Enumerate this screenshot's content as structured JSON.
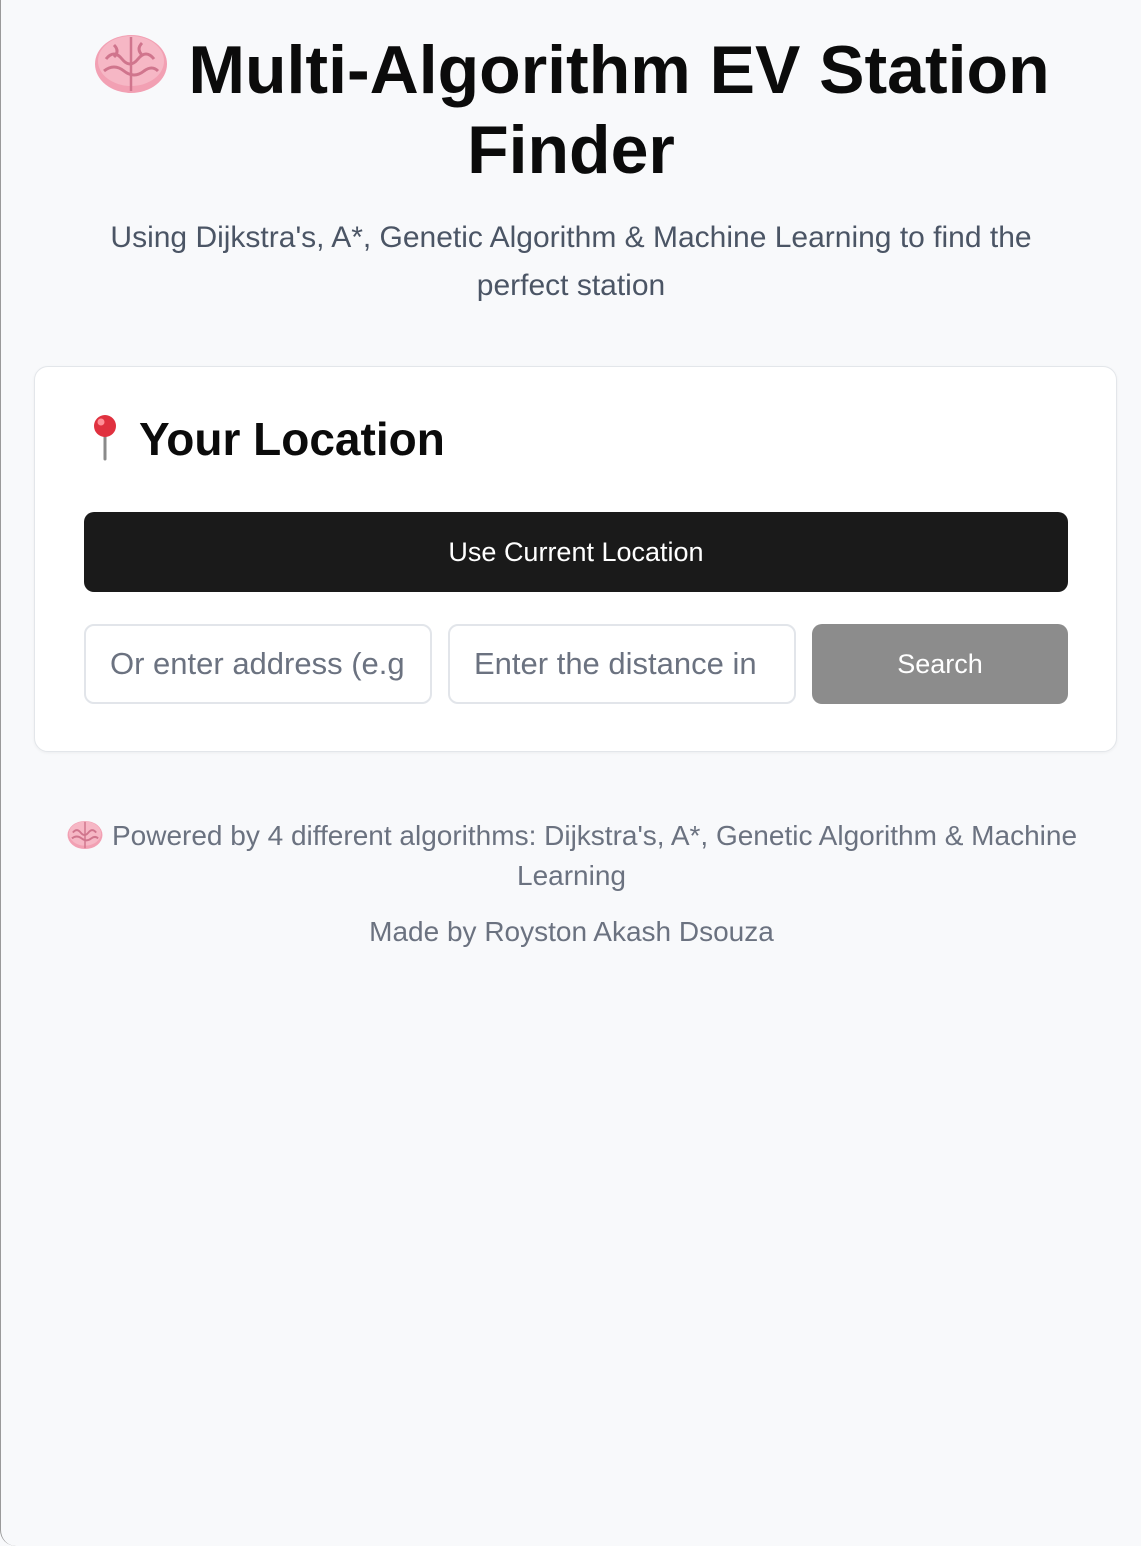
{
  "header": {
    "title": "Multi-Algorithm EV Station Finder",
    "subtitle": "Using Dijkstra's, A*, Genetic Algorithm & Machine Learning to find the perfect station",
    "icon": "brain-icon"
  },
  "location_card": {
    "title": "Your Location",
    "icon": "pin-icon",
    "use_current_label": "Use Current Location",
    "address_placeholder": "Or enter address (e.g.",
    "distance_placeholder": "Enter the distance in",
    "search_label": "Search"
  },
  "footer": {
    "powered_by": "Powered by 4 different algorithms: Dijkstra's, A*, Genetic Algorithm & Machine Learning",
    "credit": "Made by Royston Akash Dsouza",
    "icon": "brain-icon"
  },
  "colors": {
    "background": "#f8f9fb",
    "primary_button": "#1a1a1a",
    "search_button": "#8c8c8c",
    "muted_text": "#6b7280",
    "brain_pink": "#f2a0b3"
  }
}
